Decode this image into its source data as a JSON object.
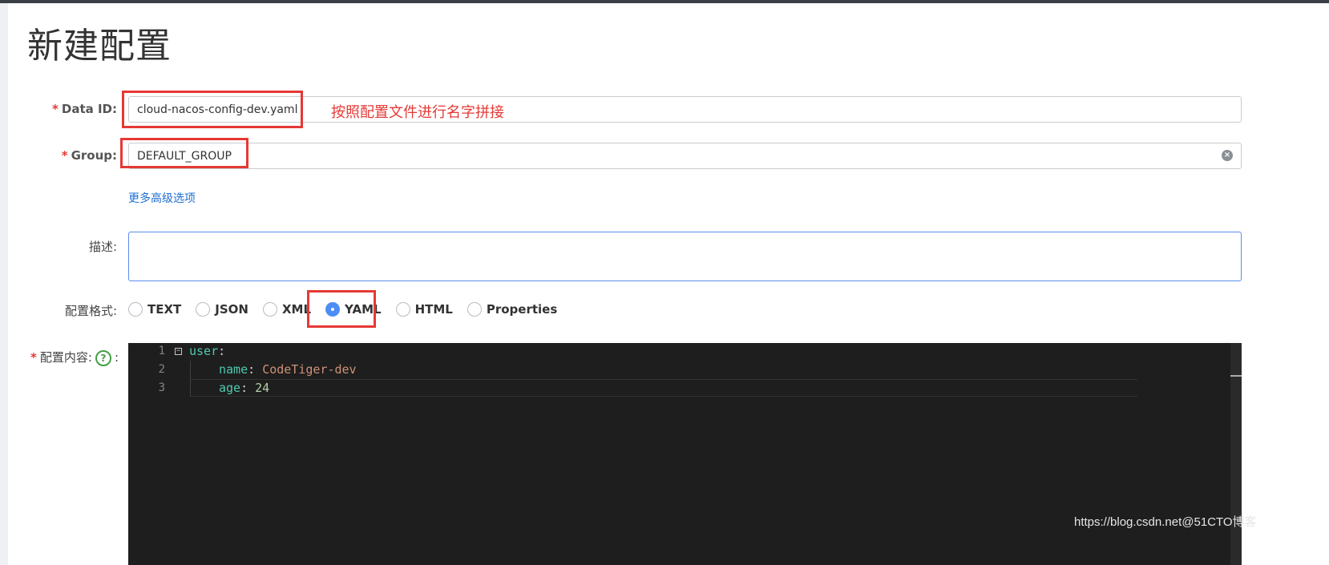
{
  "page": {
    "title": "新建配置"
  },
  "form": {
    "data_id": {
      "label": "Data ID:",
      "value": "cloud-nacos-config-dev.yaml",
      "annotation": "按照配置文件进行名字拼接"
    },
    "group": {
      "label": "Group:",
      "value": "DEFAULT_GROUP"
    },
    "advanced_link": "更多高级选项",
    "description": {
      "label": "描述:",
      "value": ""
    },
    "format": {
      "label": "配置格式:",
      "options": [
        "TEXT",
        "JSON",
        "XML",
        "YAML",
        "HTML",
        "Properties"
      ],
      "selected": "YAML"
    },
    "content": {
      "label": "配置内容:",
      "help_glyph": "?",
      "colon": ":",
      "lines": [
        {
          "num": "1",
          "key": "user",
          "sep": ":",
          "value": ""
        },
        {
          "num": "2",
          "key": "name",
          "sep": ": ",
          "value": "CodeTiger-dev"
        },
        {
          "num": "3",
          "key": "age",
          "sep": ": ",
          "value": "24"
        }
      ]
    }
  },
  "required_marker": "*",
  "watermark": "https://blog.csdn.net@51CTO博客",
  "colors": {
    "required": "#e53935",
    "highlight": "#e53935",
    "link": "#1f6fd1",
    "radio_checked": "#4c8df6",
    "editor_bg": "#1e1e1e",
    "yaml_key": "#4ec9b0",
    "yaml_string": "#ce9178",
    "yaml_number": "#b5cea8"
  }
}
